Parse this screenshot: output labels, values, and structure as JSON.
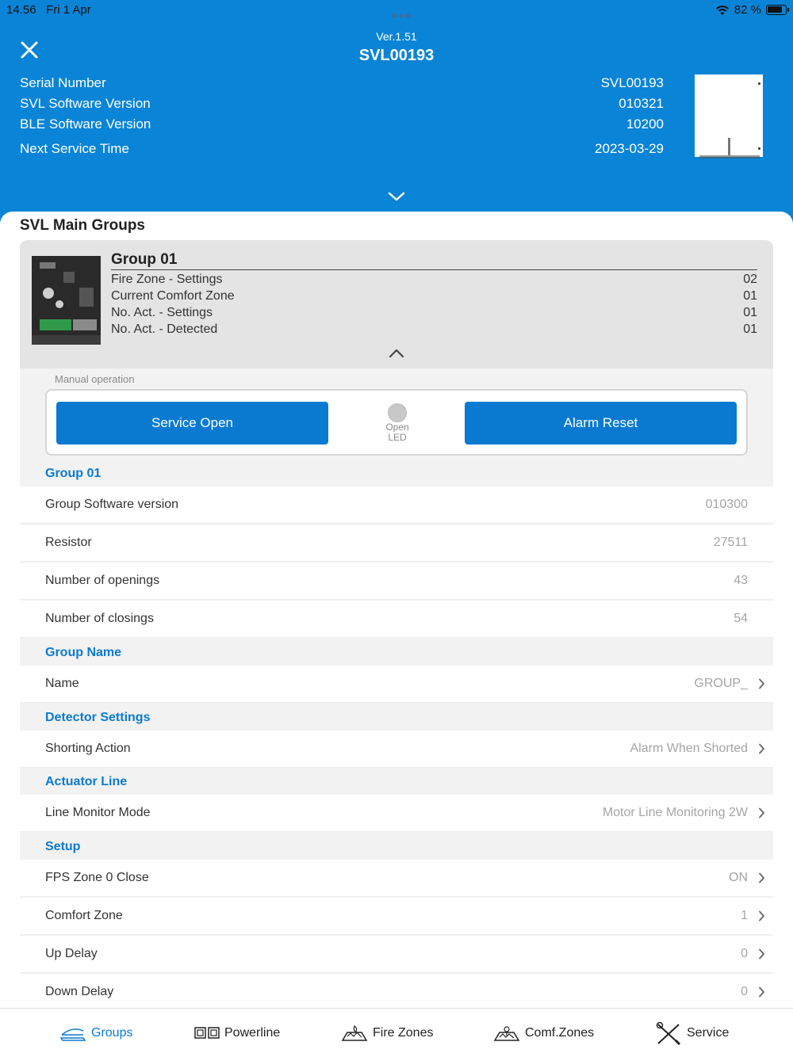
{
  "status": {
    "time": "14.56",
    "date": "Fri 1 Apr",
    "battery": "82 %"
  },
  "header": {
    "version": "Ver.1.51",
    "title": "SVL00193",
    "info": [
      {
        "label": "Serial Number",
        "value": "SVL00193"
      },
      {
        "label": "SVL Software Version",
        "value": "010321"
      },
      {
        "label": "BLE Software Version",
        "value": "10200"
      },
      {
        "label": "Next Service Time",
        "value": "2023-03-29"
      }
    ]
  },
  "main": {
    "section_title": "SVL Main Groups",
    "group": {
      "title": "Group 01",
      "rows": [
        {
          "label": "Fire Zone - Settings",
          "value": "02"
        },
        {
          "label": "Current Comfort Zone",
          "value": "01"
        },
        {
          "label": "No. Act. - Settings",
          "value": "01"
        },
        {
          "label": "No. Act. - Detected",
          "value": "01"
        }
      ]
    },
    "manual": {
      "label": "Manual operation",
      "service_open": "Service Open",
      "alarm_reset": "Alarm Reset",
      "led_line1": "Open",
      "led_line2": "LED"
    },
    "sections": {
      "group": {
        "header": "Group 01",
        "rows": [
          {
            "label": "Group Software version",
            "value": "010300"
          },
          {
            "label": "Resistor",
            "value": "27511"
          },
          {
            "label": "Number of openings",
            "value": "43"
          },
          {
            "label": "Number of closings",
            "value": "54"
          }
        ]
      },
      "group_name": {
        "header": "Group Name",
        "rows": [
          {
            "label": "Name",
            "value": "GROUP_"
          }
        ]
      },
      "detector": {
        "header": "Detector Settings",
        "rows": [
          {
            "label": "Shorting Action",
            "value": "Alarm When Shorted"
          }
        ]
      },
      "actuator": {
        "header": "Actuator Line",
        "rows": [
          {
            "label": "Line Monitor Mode",
            "value": "Motor Line Monitoring 2W"
          }
        ]
      },
      "setup": {
        "header": "Setup",
        "rows": [
          {
            "label": "FPS Zone 0 Close",
            "value": "ON"
          },
          {
            "label": "Comfort Zone",
            "value": "1"
          },
          {
            "label": "Up Delay",
            "value": "0"
          },
          {
            "label": "Down Delay",
            "value": "0"
          }
        ]
      }
    }
  },
  "tabs": [
    {
      "label": "Groups",
      "icon": "groups-icon",
      "active": true
    },
    {
      "label": "Powerline",
      "icon": "powerline-icon"
    },
    {
      "label": "Fire Zones",
      "icon": "fire-zones-icon"
    },
    {
      "label": "Comf.Zones",
      "icon": "comfort-zones-icon"
    },
    {
      "label": "Service",
      "icon": "service-icon"
    }
  ],
  "colors": {
    "accent": "#0a84d6",
    "button": "#0a7ad1",
    "section_header": "#0a7ad1"
  }
}
